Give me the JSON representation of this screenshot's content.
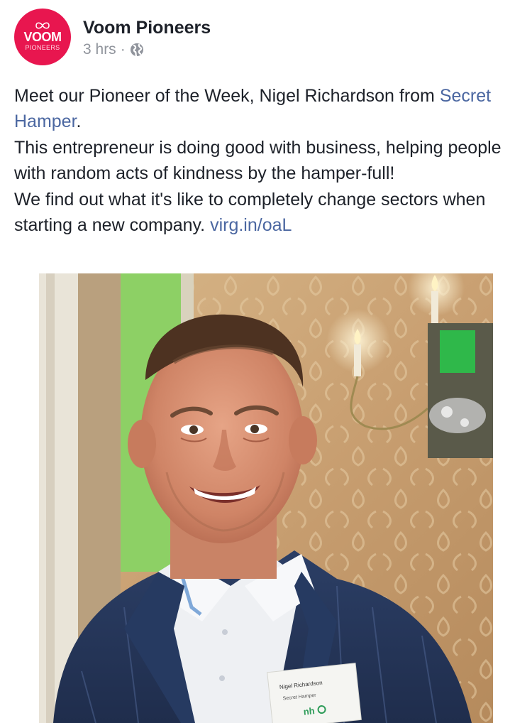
{
  "post": {
    "page_name": "Voom Pioneers",
    "timestamp": "3 hrs",
    "separator": "·",
    "privacy_icon": "globe-icon",
    "avatar": {
      "brand_main": "VOOM",
      "brand_sub": "PIONEERS",
      "icon": "infinity-icon",
      "color": "#e8164f"
    },
    "text": {
      "line1_prefix": "Meet our Pioneer of the Week, Nigel Richardson from ",
      "line1_link": "Secret Hamper",
      "line1_suffix": ".",
      "line2": "This entrepreneur is doing good with business, helping people with random acts of kindness by the hamper-full!",
      "line3_prefix": "We find out what it's like to completely change sectors when starting a new company. ",
      "line3_link": "virg.in/oaL"
    },
    "photo": {
      "badge_name": "Nigel Richardson",
      "badge_company": "Secret Hamper",
      "badge_logo": "nh"
    }
  },
  "colors": {
    "link": "#4b67a1",
    "meta": "#90949c",
    "text": "#1d2129"
  }
}
